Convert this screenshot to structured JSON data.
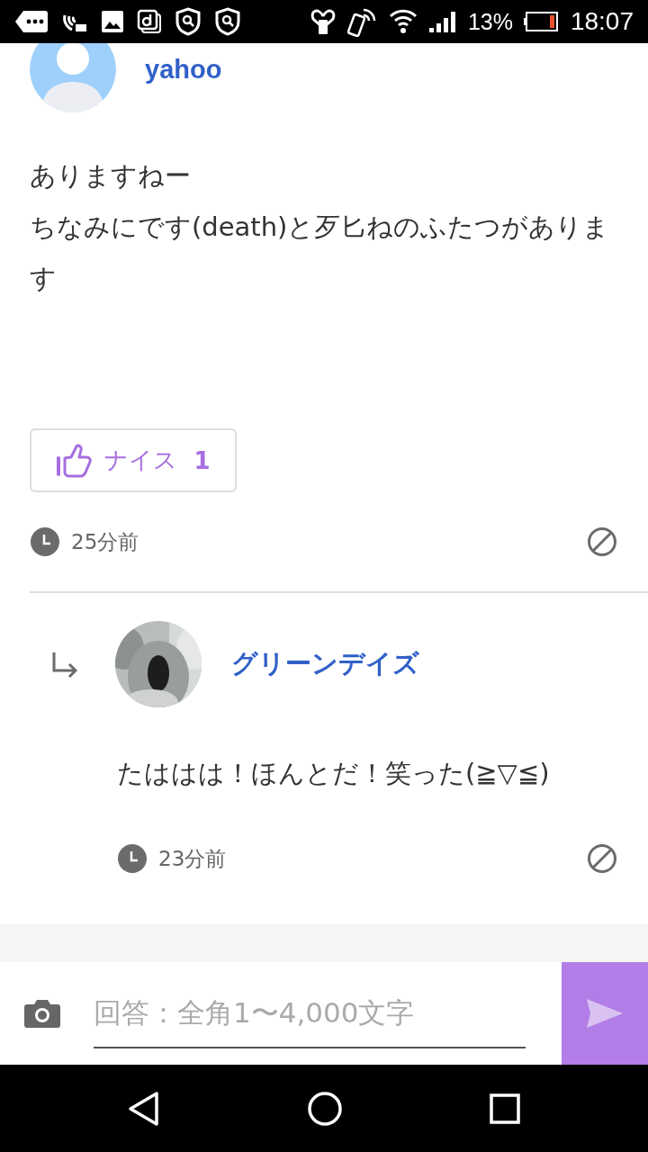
{
  "status_bar": {
    "battery": "13%",
    "time": "18:07"
  },
  "post": {
    "author": "yahoo",
    "body": [
      "ありますねー",
      "ちなみにです(death)と歹匕ねのふたつがあります"
    ],
    "nice_button": {
      "label": "ナイス",
      "count": "1"
    },
    "time": "25分前"
  },
  "reply": {
    "author": "グリーンデイズ",
    "body": "たははは！ほんとだ！笑った(≧▽≦)",
    "time": "23分前"
  },
  "composer": {
    "placeholder": "回答：全角1〜4,000文字"
  }
}
